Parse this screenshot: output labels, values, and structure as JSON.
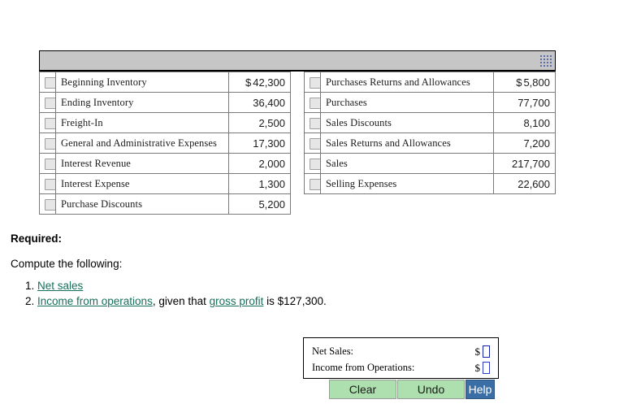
{
  "panel": {
    "header_grip_icon": "resize-grip-icon",
    "left_table": {
      "rows": [
        {
          "label": "Beginning Inventory",
          "dollar": "$",
          "value": "42,300"
        },
        {
          "label": "Ending Inventory",
          "dollar": "",
          "value": "36,400"
        },
        {
          "label": "Freight-In",
          "dollar": "",
          "value": "2,500"
        },
        {
          "label": "General and Administrative Expenses",
          "dollar": "",
          "value": "17,300"
        },
        {
          "label": "Interest Revenue",
          "dollar": "",
          "value": "2,000"
        },
        {
          "label": "Interest Expense",
          "dollar": "",
          "value": "1,300"
        },
        {
          "label": "Purchase Discounts",
          "dollar": "",
          "value": "5,200"
        }
      ]
    },
    "right_table": {
      "rows": [
        {
          "label": "Purchases Returns and Allowances",
          "dollar": "$",
          "value": "5,800"
        },
        {
          "label": "Purchases",
          "dollar": "",
          "value": "77,700"
        },
        {
          "label": "Sales Discounts",
          "dollar": "",
          "value": "8,100"
        },
        {
          "label": "Sales Returns and Allowances",
          "dollar": "",
          "value": "7,200"
        },
        {
          "label": "Sales",
          "dollar": "",
          "value": "217,700"
        },
        {
          "label": "Selling Expenses",
          "dollar": "",
          "value": "22,600"
        }
      ]
    }
  },
  "required": {
    "title": "Required:",
    "intro": "Compute the following:",
    "item1_link": "Net sales",
    "item2_link": "Income from operations",
    "item2_mid": ", given that ",
    "item2_link2": "gross profit",
    "item2_tail": " is $127,300."
  },
  "answer": {
    "net_sales_label": "Net Sales:",
    "net_sales_dollar": "$",
    "net_sales_value": "",
    "income_label": "Income from Operations:",
    "income_dollar": "$",
    "income_value": "",
    "buttons": {
      "clear": "Clear",
      "undo": "Undo",
      "help": "Help"
    }
  },
  "colors": {
    "link": "#16705c",
    "header_bar": "#c6c6c6",
    "button_green": "#aedfae",
    "button_blue": "#3a6ea5",
    "input_border": "#2b3ecb"
  }
}
